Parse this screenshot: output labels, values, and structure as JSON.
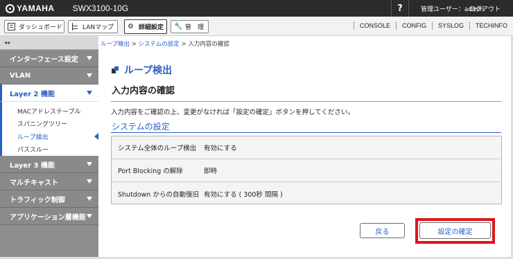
{
  "header": {
    "brand": "YAMAHA",
    "model": "SWX3100-10G",
    "help": "?",
    "user": "管理ユーザー：admin",
    "logout": "ログアウト"
  },
  "nav": {
    "dashboard": "ダッシュボード",
    "lanmap": "LANマップ",
    "detail": "詳細設定",
    "management": "管　理",
    "links": [
      "CONSOLE",
      "CONFIG",
      "SYSLOG",
      "TECHINFO"
    ]
  },
  "sidebar": {
    "collapse": "◂◂",
    "sections": [
      "インターフェース設定",
      "VLAN",
      "Layer 2 機能",
      "Layer 3 機能",
      "マルチキャスト",
      "トラフィック制御",
      "アプリケーション層機能"
    ],
    "layer2_items": [
      "MACアドレステーブル",
      "スパニングツリー",
      "ループ検出",
      "パススルー"
    ]
  },
  "breadcrumb": {
    "item1": "ループ検出",
    "sep": " > ",
    "item2": "システムの設定",
    "item3": "入力内容の確認"
  },
  "page": {
    "heading": "ループ検出",
    "subtitle": "入力内容の確認",
    "description": "入力内容をご確認の上、変更がなければ「設定の確定」ボタンを押してください。",
    "section_title": "システムの設定"
  },
  "table": {
    "rows": [
      {
        "label": "システム全体のループ検出",
        "value": "有効にする"
      },
      {
        "label": "Port Blocking の解除",
        "value": "即時"
      },
      {
        "label": "Shutdown からの自動復旧",
        "value": "有効にする ( 300秒 間隔 )"
      }
    ]
  },
  "buttons": {
    "back": "戻る",
    "confirm": "設定の確定"
  },
  "colors": {
    "accent": "#2a5fc7",
    "highlight": "#e0141a",
    "topbar": "#2b2b2b"
  }
}
